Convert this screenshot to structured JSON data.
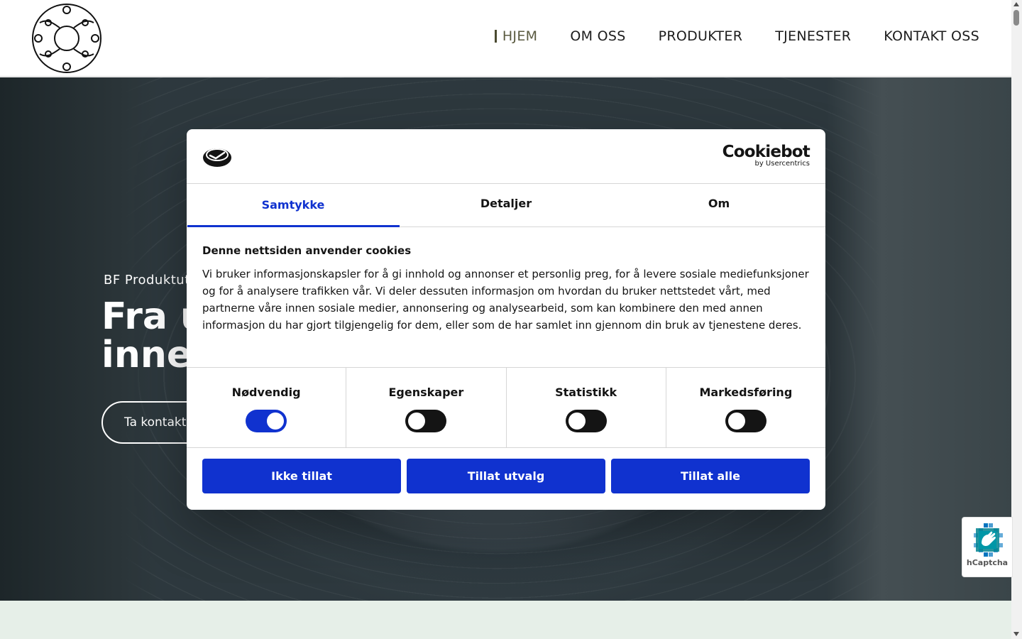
{
  "nav": {
    "items": [
      {
        "label": "HJEM",
        "active": true
      },
      {
        "label": "OM OSS",
        "active": false
      },
      {
        "label": "PRODUKTER",
        "active": false
      },
      {
        "label": "TJENESTER",
        "active": false
      },
      {
        "label": "KONTAKT OSS",
        "active": false
      }
    ]
  },
  "hero": {
    "kicker": "BF Produktut",
    "title_line1": "Fra u",
    "title_line2": "inne",
    "button_label": "Ta kontakt"
  },
  "cookie_dialog": {
    "brand_name": "Cookiebot",
    "brand_sub": "by Usercentrics",
    "tabs": [
      {
        "label": "Samtykke",
        "active": true
      },
      {
        "label": "Detaljer",
        "active": false
      },
      {
        "label": "Om",
        "active": false
      }
    ],
    "heading": "Denne nettsiden anvender cookies",
    "body": "Vi bruker informasjonskapsler for å gi innhold og annonser et personlig preg, for å levere sosiale mediefunksjoner og for å analysere trafikken vår. Vi deler dessuten informasjon om hvordan du bruker nettstedet vårt, med partnerne våre innen sosiale medier, annonsering og analysearbeid, som kan kombinere den med annen informasjon du har gjort tilgjengelig for dem, eller som de har samlet inn gjennom din bruk av tjenestene deres.",
    "preferences": [
      {
        "label": "Nødvendig",
        "enabled": true
      },
      {
        "label": "Egenskaper",
        "enabled": false
      },
      {
        "label": "Statistikk",
        "enabled": false
      },
      {
        "label": "Markedsføring",
        "enabled": false
      }
    ],
    "actions": {
      "deny": "Ikke tillat",
      "allow_selection": "Tillat utvalg",
      "allow_all": "Tillat alle"
    }
  },
  "captcha": {
    "label": "hCaptcha"
  },
  "colors": {
    "accent": "#1032cf",
    "text": "#141414",
    "strip": "#e6efe8"
  }
}
